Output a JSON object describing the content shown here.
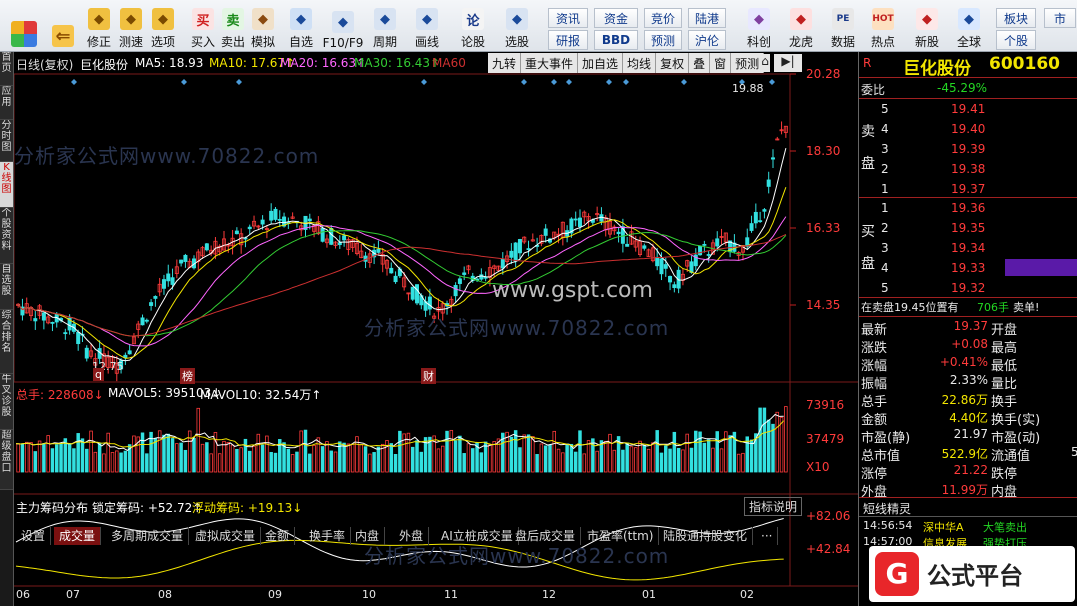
{
  "toolbar": {
    "buttons": [
      {
        "label": "修正",
        "icon": "up-down-arrow-icon"
      },
      {
        "label": "测速",
        "icon": "smiley-icon"
      },
      {
        "label": "选项",
        "icon": "options-icon"
      },
      {
        "label": "买入",
        "icon": "buy-icon",
        "glyph": "买"
      },
      {
        "label": "卖出",
        "icon": "sell-icon",
        "glyph": "卖"
      },
      {
        "label": "模拟",
        "icon": "hammer-icon"
      },
      {
        "label": "自选",
        "icon": "star-folder-icon"
      },
      {
        "label": "F10/F9",
        "icon": "f10-icon"
      },
      {
        "label": "周期",
        "icon": "period-icon"
      },
      {
        "label": "画线",
        "icon": "pencil-icon"
      },
      {
        "label": "论股",
        "icon": "discuss-icon",
        "glyph": "论"
      },
      {
        "label": "选股",
        "icon": "stock-pick-icon"
      },
      {
        "label": "科创",
        "icon": "kechuang-icon"
      },
      {
        "label": "龙虎",
        "icon": "dragon-tiger-icon"
      },
      {
        "label": "数据",
        "icon": "pe-data-icon",
        "glyph": "PE"
      },
      {
        "label": "热点",
        "icon": "hot-icon",
        "glyph": "HOT"
      },
      {
        "label": "新股",
        "icon": "new-stock-icon"
      },
      {
        "label": "全球",
        "icon": "globe-icon"
      }
    ],
    "small_buttons": [
      "资讯",
      "研报",
      "资金",
      "BBD",
      "竞价",
      "预测",
      "陆港",
      "沪伦",
      "板块",
      "个股",
      "市"
    ]
  },
  "left_tabs": [
    "首页",
    "应用",
    "分时图",
    "K线图",
    "个股资料",
    "自选股",
    "综合排名",
    "牛叉诊股",
    "超级盘口"
  ],
  "chart": {
    "header": {
      "period": "日线(复权)",
      "name": "巨化股份",
      "ma5": "MA5: 18.93",
      "ma10": "MA10: 17.67↑",
      "ma20": "MA20: 16.63↑",
      "ma30": "MA30: 16.43↑",
      "ma60": "MA60"
    },
    "menu": [
      "九转",
      "重大事件",
      "加自选",
      "均线",
      "复权",
      "叠",
      "窗",
      "预测"
    ],
    "price_ticks": [
      "20.28",
      "18.30",
      "16.33",
      "14.35"
    ],
    "annot_high": "19.88",
    "annot_low": "12.75",
    "markers": [
      "q",
      "榜",
      "财"
    ],
    "watermark_main": "www.gspt.com",
    "watermark_bg": "分析家公式网www.70822.com",
    "vol_header": {
      "total": "总手: 228608↓",
      "mavol5": "MAVOL5: 395103↓",
      "mavol10": "MAVOL10: 32.54万↑"
    },
    "vol_ticks": [
      "73916",
      "37479",
      "X10"
    ],
    "tabs": [
      "设置",
      "成交量",
      "多周期成交量",
      "虚拟成交量",
      "金额",
      "换手率",
      "内盘",
      "外盘",
      "AI立桩成交量",
      "盘后成交量",
      "市盈率(ttm)",
      "陆股通持股变化",
      "···"
    ],
    "ind_header": {
      "name": "主力筹码分布",
      "lock": "锁定筹码: +52.72↑",
      "float": "浮动筹码: +19.13↓",
      "help": "指标说明"
    },
    "ind_ticks": [
      "+82.06",
      "+42.84"
    ],
    "months": [
      "06",
      "07",
      "08",
      "09",
      "10",
      "11",
      "12",
      "01",
      "02"
    ],
    "colors": {
      "up": "#ff3b3b",
      "down": "#33e0e0",
      "ma5": "#ffffff",
      "ma10": "#f3e600",
      "ma20": "#ff66ff",
      "ma30": "#33cc33",
      "ma60": "#cc3030"
    }
  },
  "panel": {
    "title": "巨化股份",
    "code": "600160",
    "r_label": "R",
    "weibi_label": "委比",
    "weibi": "-45.29%",
    "sell_label": [
      "卖",
      "盘"
    ],
    "buy_label": [
      "买",
      "盘"
    ],
    "sells": [
      {
        "n": "5",
        "price": "19.41"
      },
      {
        "n": "4",
        "price": "19.40"
      },
      {
        "n": "3",
        "price": "19.39"
      },
      {
        "n": "2",
        "price": "19.38"
      },
      {
        "n": "1",
        "price": "19.37"
      }
    ],
    "buys": [
      {
        "n": "1",
        "price": "19.36"
      },
      {
        "n": "2",
        "price": "19.35"
      },
      {
        "n": "3",
        "price": "19.34"
      },
      {
        "n": "4",
        "price": "19.33"
      },
      {
        "n": "5",
        "price": "19.32"
      }
    ],
    "notice": "在卖盘19.45位置有",
    "notice_vol": "706手",
    "notice_end": "卖单!",
    "quotes": [
      {
        "l1": "最新",
        "v1": "19.37",
        "l2": "开盘",
        "v2": ""
      },
      {
        "l1": "涨跌",
        "v1": "+0.08",
        "l2": "最高",
        "v2": ""
      },
      {
        "l1": "涨幅",
        "v1": "+0.41%",
        "l2": "最低",
        "v2": ""
      },
      {
        "l1": "振幅",
        "v1": "2.33%",
        "l2": "量比",
        "v2": ""
      },
      {
        "l1": "总手",
        "v1": "22.86万",
        "l2": "换手",
        "v2": ""
      },
      {
        "l1": "金额",
        "v1": "4.40亿",
        "l2": "换手(实)",
        "v2": ""
      },
      {
        "l1": "市盈(静)",
        "v1": "21.97",
        "l2": "市盈(动)",
        "v2": ""
      },
      {
        "l1": "总市值",
        "v1": "522.9亿",
        "l2": "流通值",
        "v2": "5"
      },
      {
        "l1": "涨停",
        "v1": "21.22",
        "l2": "跌停",
        "v2": ""
      },
      {
        "l1": "外盘",
        "v1": "11.99万",
        "l2": "内盘",
        "v2": ""
      }
    ],
    "wizard_title": "短线精灵",
    "wizard": [
      {
        "time": "14:56:54",
        "name": "深中华A",
        "event": "大笔卖出"
      },
      {
        "time": "14:57:00",
        "name": "信息发展",
        "event": "强势打压"
      }
    ],
    "brand": "公式平台",
    "brand_icon": "G"
  }
}
